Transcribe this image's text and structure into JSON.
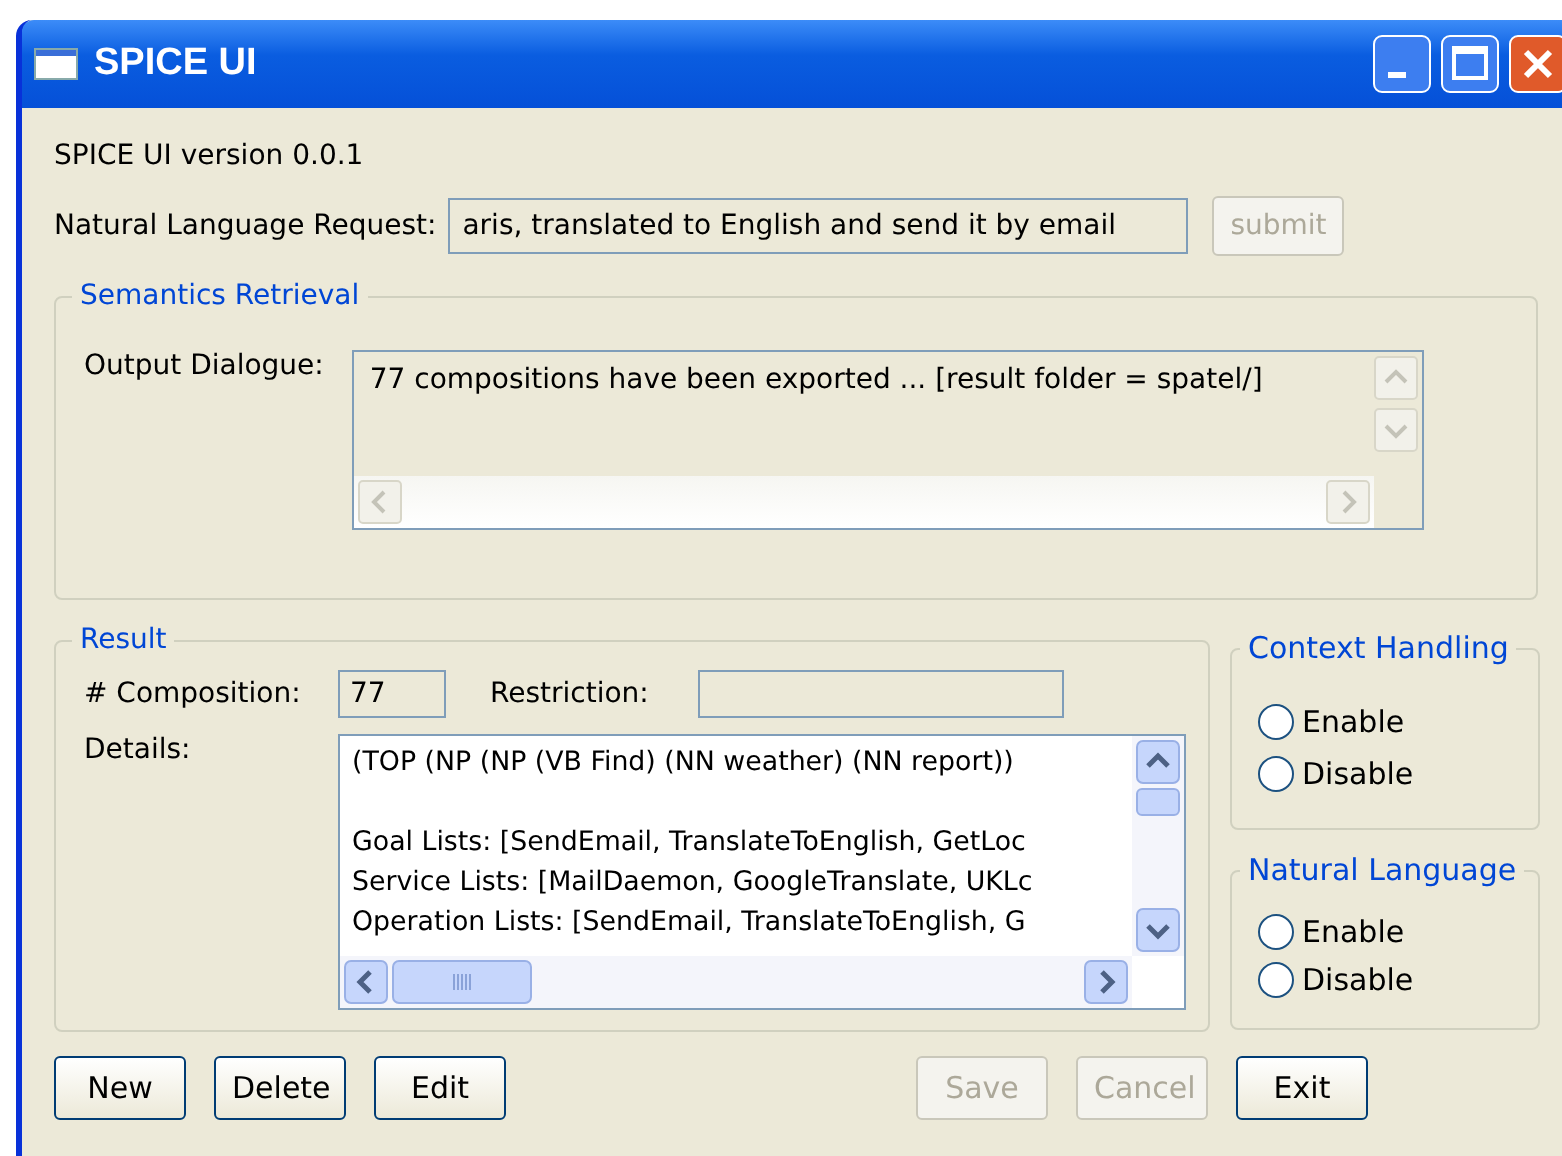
{
  "window": {
    "title": "SPICE UI"
  },
  "version_label": "SPICE UI version 0.0.1",
  "request": {
    "label": "Natural Language Request:",
    "value": "aris, translated to English and send it by email",
    "submit": {
      "label": "submit",
      "disabled": true
    }
  },
  "semantics": {
    "title": "Semantics Retrieval",
    "output_label": "Output Dialogue:",
    "output_lines": [
      "77 compositions have been exported ... [result folder = spatel/]"
    ]
  },
  "result": {
    "title": "Result",
    "composition_label": "# Composition:",
    "composition_value": "77",
    "restriction_label": "Restriction:",
    "details_label": "Details:",
    "details_paragraphs": [
      [
        "(TOP (NP (NP (VB Find) (NN weather) (NN report))"
      ],
      [
        "Goal Lists: [SendEmail, TranslateToEnglish, GetLoc",
        "Service Lists: [MailDaemon, GoogleTranslate, UKLc",
        "Operation Lists: [SendEmail, TranslateToEnglish, G"
      ]
    ]
  },
  "option_groups": [
    {
      "title": "Context Handling",
      "options": [
        {
          "label": "Enable",
          "selected": false
        },
        {
          "label": "Disable",
          "selected": false
        }
      ]
    },
    {
      "title": "Natural Language",
      "options": [
        {
          "label": "Enable",
          "selected": false
        },
        {
          "label": "Disable",
          "selected": false
        }
      ]
    }
  ],
  "buttons_left": [
    {
      "label": "New",
      "disabled": false
    },
    {
      "label": "Delete",
      "disabled": false
    },
    {
      "label": "Edit",
      "disabled": false
    }
  ],
  "buttons_right": [
    {
      "label": "Save",
      "disabled": true
    },
    {
      "label": "Cancel",
      "disabled": true
    },
    {
      "label": "Exit",
      "disabled": false
    }
  ]
}
